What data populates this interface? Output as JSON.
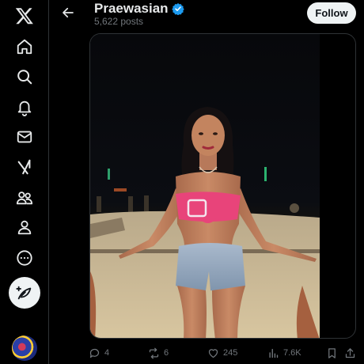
{
  "nav": {
    "items": [
      {
        "icon": "x-logo-icon"
      },
      {
        "icon": "home-icon"
      },
      {
        "icon": "search-icon"
      },
      {
        "icon": "bell-icon"
      },
      {
        "icon": "mail-icon"
      },
      {
        "icon": "grok-icon"
      },
      {
        "icon": "communities-icon"
      },
      {
        "icon": "profile-icon"
      },
      {
        "icon": "more-icon"
      }
    ],
    "post_icon": "feather-plus-icon"
  },
  "header": {
    "name": "Praewasian",
    "verified": true,
    "post_count": "5,622 posts",
    "follow_label": "Follow"
  },
  "actions": {
    "replies": "4",
    "reposts": "6",
    "likes": "245",
    "views": "7.6K"
  },
  "colors": {
    "background": "#000000",
    "text": "#e7e9ea",
    "muted": "#71767b",
    "verified": "#1d9bf0",
    "button_bg": "#eff3f4"
  }
}
